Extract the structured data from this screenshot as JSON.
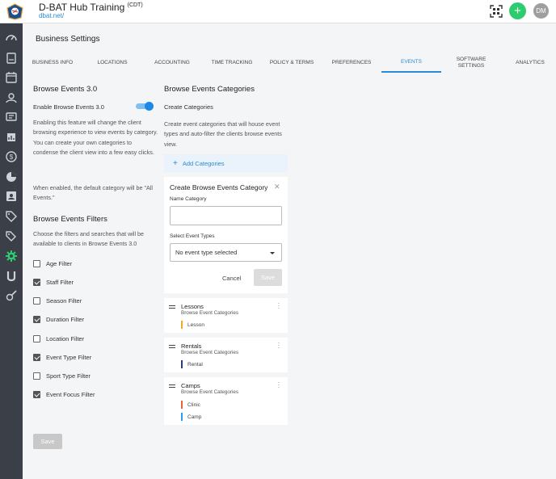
{
  "app": {
    "title": "D-BAT Hub Training",
    "tz": "(CDT)",
    "url": "dbat.net/",
    "avatar_initials": "DM",
    "add_label": "+"
  },
  "page": {
    "title": "Business Settings"
  },
  "tabs": [
    {
      "label": "BUSINESS INFO"
    },
    {
      "label": "LOCATIONS"
    },
    {
      "label": "ACCOUNTING"
    },
    {
      "label": "TIME TRACKING"
    },
    {
      "label": "POLICY & TERMS"
    },
    {
      "label": "PREFERENCES"
    },
    {
      "label": "EVENTS",
      "active": true
    },
    {
      "label": "SOFTWARE SETTINGS"
    },
    {
      "label": "ANALYTICS"
    }
  ],
  "browse_events": {
    "title": "Browse Events 3.0",
    "enable_label": "Enable Browse Events 3.0",
    "enabled": true,
    "description": "Enabling this feature will change the client browsing experience to view events by category. You can create your own categories to condense the client view into a few easy clicks.",
    "default_note": "When enabled, the default category will be \"All Events.\""
  },
  "filters": {
    "title": "Browse Events Filters",
    "description": "Choose the filters and searches that will be available to clients in Browse Events 3.0",
    "items": [
      {
        "label": "Age Filter",
        "checked": false
      },
      {
        "label": "Staff Filter",
        "checked": true
      },
      {
        "label": "Season Filter",
        "checked": false
      },
      {
        "label": "Duration Filter",
        "checked": true
      },
      {
        "label": "Location Filter",
        "checked": false
      },
      {
        "label": "Event Type Filter",
        "checked": true
      },
      {
        "label": "Sport Type Filter",
        "checked": false
      },
      {
        "label": "Event Focus Filter",
        "checked": true
      }
    ]
  },
  "save_label": "Save",
  "categories": {
    "title": "Browse Events Categories",
    "create_heading": "Create Categories",
    "description": "Create event categories that will house event types and auto-filter the clients browse events view.",
    "add_label": "Add Categories",
    "modal": {
      "title": "Create Browse Events Category",
      "name_label": "Name Category",
      "name_value": "",
      "type_label": "Select Event Types",
      "type_value": "No event type selected",
      "cancel_label": "Cancel",
      "save_label": "Save"
    },
    "list": [
      {
        "name": "Lessons",
        "sub": "Browse Event Categories",
        "types": [
          {
            "label": "Lesson",
            "color": "#f5a623"
          }
        ]
      },
      {
        "name": "Rentals",
        "sub": "Browse Event Categories",
        "types": [
          {
            "label": "Rental",
            "color": "#2c3e78"
          }
        ]
      },
      {
        "name": "Camps",
        "sub": "Browse Event Categories",
        "types": [
          {
            "label": "Clinic",
            "color": "#e8623a"
          },
          {
            "label": "Camp",
            "color": "#2a9df4"
          }
        ]
      }
    ]
  },
  "colors": {
    "accent": "#2a8ad4",
    "add_button": "#2ecc71",
    "sidebar": "#3a3f48",
    "active_sidebar_icon": "#2ecc71"
  },
  "sidebar_icons": [
    "dashboard-icon",
    "book-icon",
    "calendar-icon",
    "users-icon",
    "chat-icon",
    "reports-icon",
    "money-icon",
    "pie-chart-icon",
    "contact-card-icon",
    "tag-icon",
    "tags-icon",
    "settings-icon",
    "university-icon",
    "tools-icon"
  ]
}
